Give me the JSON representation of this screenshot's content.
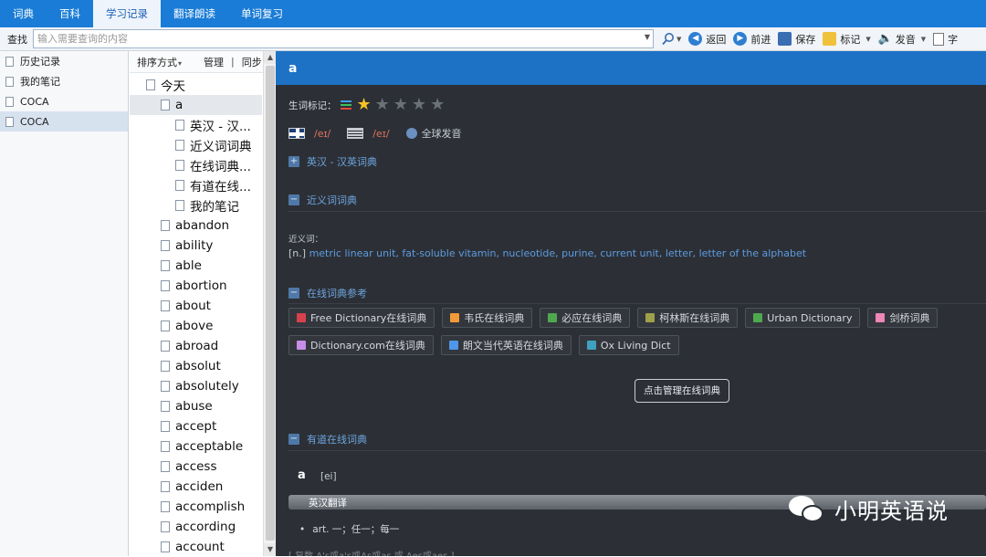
{
  "tabs": [
    "词典",
    "百科",
    "学习记录",
    "翻译朗读",
    "单词复习"
  ],
  "active_tab": "学习记录",
  "toolbar": {
    "search_label": "查找",
    "search_placeholder": "输入需要查询的内容",
    "buttons": {
      "back": "返回",
      "forward": "前进",
      "save": "保存",
      "mark": "标记",
      "speak": "发音",
      "more": "字"
    }
  },
  "left_list": {
    "items": [
      "历史记录",
      "我的笔记",
      "COCA",
      "COCA"
    ],
    "selected_index": 3
  },
  "tree": {
    "sort_label": "排序方式",
    "manage_label": "管理",
    "separator": "|",
    "sync_label": "同步",
    "root": "今天",
    "current_word": "a",
    "sub_items": [
      "英汉 - 汉...",
      "近义词词典",
      "在线词典...",
      "有道在线...",
      "我的笔记"
    ],
    "words": [
      "abandon",
      "ability",
      "able",
      "abortion",
      "about",
      "above",
      "abroad",
      "absolut",
      "absolutely",
      "abuse",
      "accept",
      "acceptable",
      "access",
      "acciden",
      "accomplish",
      "according",
      "account"
    ]
  },
  "entry": {
    "word": "a",
    "mark_label": "生词标记：",
    "stars_total": 5,
    "stars_on": 1,
    "star_glyph": "★",
    "uk_phonetic": "/eɪ/",
    "us_phonetic": "/eɪ/",
    "global_label": "全球发音",
    "sections": {
      "ech": {
        "toggle": "+",
        "title": "英汉 - 汉英词典"
      },
      "synonym": {
        "toggle": "−",
        "title": "近义词词典",
        "label": "近义词：",
        "pos": "[n.]",
        "words": "metric linear unit, fat-soluble vitamin, nucleotide, purine, current unit, letter, letter of the alphabet"
      },
      "online": {
        "toggle": "−",
        "title": "在线词典参考",
        "manage_button": "点击管理在线词典"
      },
      "youdao": {
        "toggle": "−",
        "title": "有道在线词典",
        "word": "a",
        "phonetic": "[ei]",
        "bar_label": "英汉翻译",
        "definition": "art. 一；任一；每一",
        "extra": "[ 复数 A's或a's或As或as 或 Aes或aes ]"
      }
    },
    "online_dicts_row1": [
      {
        "name": "Free Dictionary在线词典",
        "color": "#d9404e"
      },
      {
        "name": "韦氏在线词典",
        "color": "#f29a38"
      },
      {
        "name": "必应在线词典",
        "color": "#4fa84e"
      },
      {
        "name": "柯林斯在线词典",
        "color": "#9ea04a"
      },
      {
        "name": "Urban Dictionary",
        "color": "#4fa84e"
      },
      {
        "name": "剑桥词典",
        "color": "#ee86b8"
      }
    ],
    "online_dicts_row2": [
      {
        "name": "Dictionary.com在线词典",
        "color": "#c88de8"
      },
      {
        "name": "朗文当代英语在线词典",
        "color": "#4e97e8"
      },
      {
        "name": "Ox Living Dict",
        "color": "#3fa0c0"
      }
    ]
  },
  "watermark": "小明英语说",
  "colors": {
    "tab_bar": "#1a7cd6",
    "header_blue": "#1d72c6",
    "dark_bg": "#2c3036",
    "link_blue": "#5e9be0",
    "phonetic_red": "#e0705e",
    "star_gold": "#f6c324"
  }
}
